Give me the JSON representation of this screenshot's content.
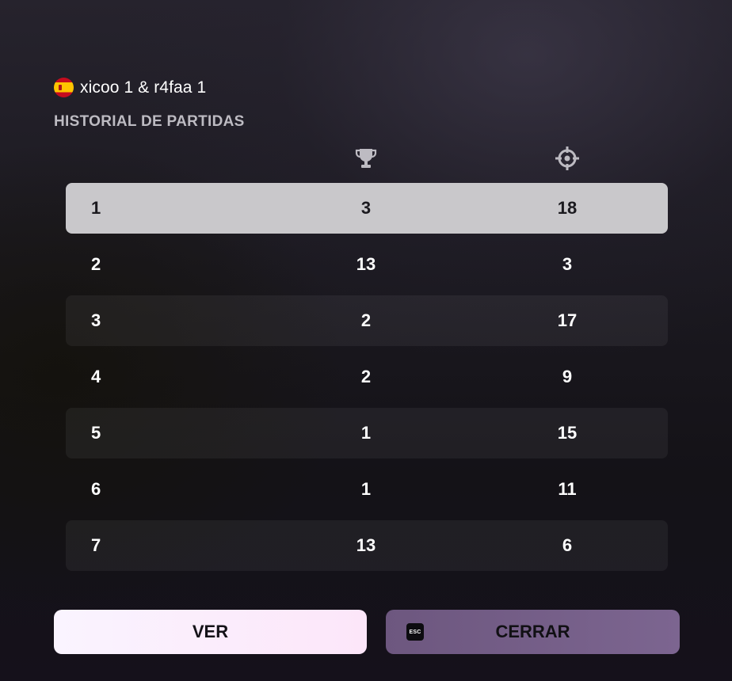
{
  "header": {
    "flag_icon": "spain-flag-icon",
    "players": "xicoo 1 & r4faa 1"
  },
  "section_title": "HISTORIAL DE PARTIDAS",
  "columns": {
    "trophy_icon": "trophy-icon",
    "kills_icon": "crosshair-icon"
  },
  "rows": [
    {
      "rank": "1",
      "trophies": "3",
      "kills": "18",
      "selected": true
    },
    {
      "rank": "2",
      "trophies": "13",
      "kills": "3"
    },
    {
      "rank": "3",
      "trophies": "2",
      "kills": "17"
    },
    {
      "rank": "4",
      "trophies": "2",
      "kills": "9"
    },
    {
      "rank": "5",
      "trophies": "1",
      "kills": "15"
    },
    {
      "rank": "6",
      "trophies": "1",
      "kills": "11"
    },
    {
      "rank": "7",
      "trophies": "13",
      "kills": "6"
    }
  ],
  "buttons": {
    "view_label": "VER",
    "close_label": "CERRAR",
    "close_key": "ESC"
  },
  "colors": {
    "highlight_row": "#c9c8cb",
    "view_button": "#fcecfb",
    "close_button": "#735d86",
    "section_title": "#bdbbc2"
  }
}
